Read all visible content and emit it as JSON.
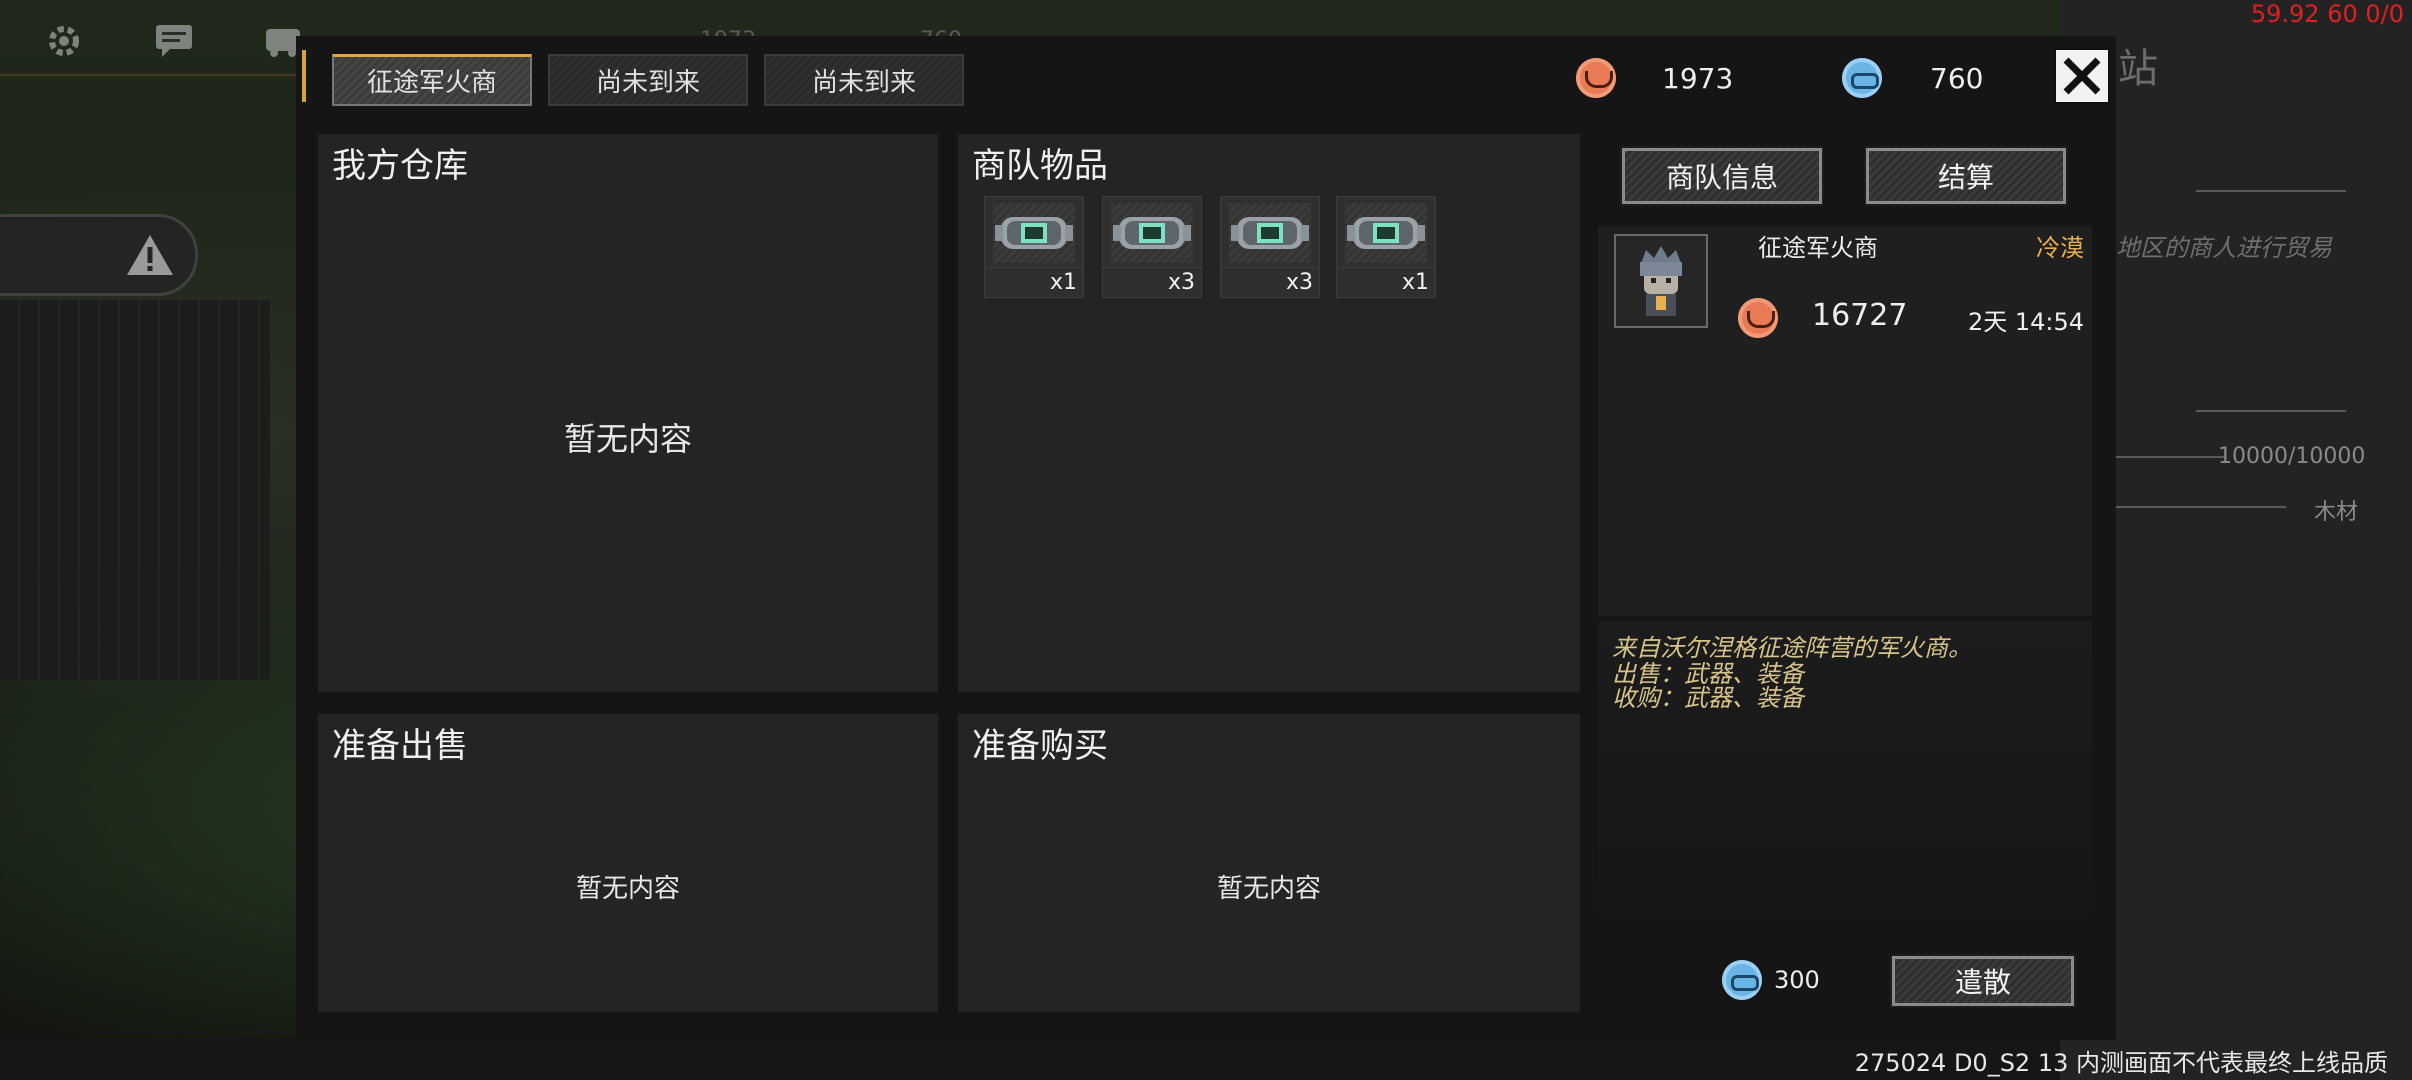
{
  "debug": {
    "fps": "59.92 60 0/0",
    "build": "275024 D0_S2 13  内测画面不代表最终上线品质"
  },
  "background": {
    "top_values": [
      "1973",
      "760"
    ],
    "right_panel_title": "站",
    "right_panel_desc": "地区的商人进行贸易",
    "right_panel_capacity": "10000/10000",
    "right_panel_resource": "木材"
  },
  "tabs": [
    {
      "label": "征途军火商",
      "active": true
    },
    {
      "label": "尚未到来",
      "active": false
    },
    {
      "label": "尚未到来",
      "active": false
    }
  ],
  "currency": {
    "orange": "1973",
    "blue": "760"
  },
  "panels": {
    "my_storage": {
      "title": "我方仓库",
      "empty": "暂无内容"
    },
    "caravan_items": {
      "title": "商队物品",
      "items": [
        {
          "icon": "armor-plate-icon",
          "qty": "x1"
        },
        {
          "icon": "armor-plate-icon",
          "qty": "x3"
        },
        {
          "icon": "armor-plate-icon",
          "qty": "x3"
        },
        {
          "icon": "armor-plate-icon",
          "qty": "x1"
        }
      ]
    },
    "to_sell": {
      "title": "准备出售",
      "empty": "暂无内容"
    },
    "to_buy": {
      "title": "准备购买",
      "empty": "暂无内容"
    }
  },
  "side": {
    "info_button": "商队信息",
    "settle_button": "结算",
    "merchant_name": "征途军火商",
    "merchant_attitude": "冷漠",
    "merchant_funds": "16727",
    "merchant_time": "2天 14:54",
    "description": [
      "来自沃尔涅格征途阵营的军火商。",
      "出售：武器、装备",
      "收购：武器、装备"
    ],
    "dismiss_cost": "300",
    "dismiss_button": "遣散"
  },
  "colors": {
    "accent": "#e7a63c",
    "orange_coin": "#e87a56",
    "blue_coin": "#6ab4e6",
    "attitude": "#e7b04c"
  }
}
